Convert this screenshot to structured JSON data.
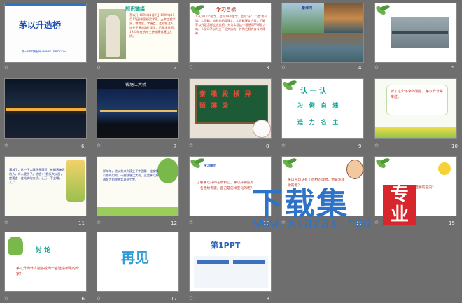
{
  "slides": [
    {
      "num": "1",
      "title": "茅以升造桥",
      "footer": "第一PPT模板网-WWW.1PPT.COM"
    },
    {
      "num": "2",
      "heading": "知识链接",
      "body": "茅以升(1896年1月9日-1989年11月12日)中国桥梁学家、土木工程学家、教育家。字唐臣，江苏镇江人。毕业于唐山路矿学堂，后留学美国。1935年在杭州主持修建钱塘江大桥。"
    },
    {
      "num": "3",
      "heading": "学习目标",
      "body": "1.认识12个生字，会写14个生字，会写“于”、“造”等词语。2.正确、流利地朗读课文。3.理解课文内容，了解茅以升是怎样立志造桥，并为实现这个理想而不断努力的。4.学习茅以升立下远大志向，并为之努力奋斗的精神。"
    },
    {
      "num": "4",
      "caption": "秦淮河"
    },
    {
      "num": "5"
    },
    {
      "num": "6"
    },
    {
      "num": "7",
      "caption": "钱塘江大桥"
    },
    {
      "num": "8",
      "board": "秦  塌  殿  横  异  硕  薄  梁"
    },
    {
      "num": "9",
      "heading": "认 一 认",
      "row1": "为 倒 白 违",
      "row2": "造 力 名 主"
    },
    {
      "num": "10",
      "body": "听了这个不幸的消息，茅以升非常难过。"
    },
    {
      "num": "11",
      "body": "满城了，这一下人踩死多落河，被翻滚淹死的人，有人受伤了。他想：“我长大以后，一定要造一座结实的大桥，让万一不会塌，人。”"
    },
    {
      "num": "12",
      "body": "那年年，他以为来到建立了中国第一座钢铁公路两用的，一座钱塘江大桥。这是茅以升最努力的理想实现这个梦。"
    },
    {
      "num": "13",
      "tag": "学习提示",
      "body": "了解茅以升的志情和心，茅以升要成为一名造桥专家，自己是怎样变化的呢？"
    },
    {
      "num": "14",
      "body": "茅以升自从有了造桥的理想，他是怎样做的呢？"
    },
    {
      "num": "15",
      "body": "茅以升为什么能立下造桥的志向？"
    },
    {
      "num": "16",
      "heading": "讨 论",
      "body": "茅以升为什么能够成为一名建造桥梁的专家？"
    },
    {
      "num": "17",
      "title": "再见"
    },
    {
      "num": "18",
      "logo": "第1PPT"
    }
  ],
  "watermark": {
    "text": "下载集",
    "site": "www.xiazai.red",
    "seal": "专业"
  }
}
